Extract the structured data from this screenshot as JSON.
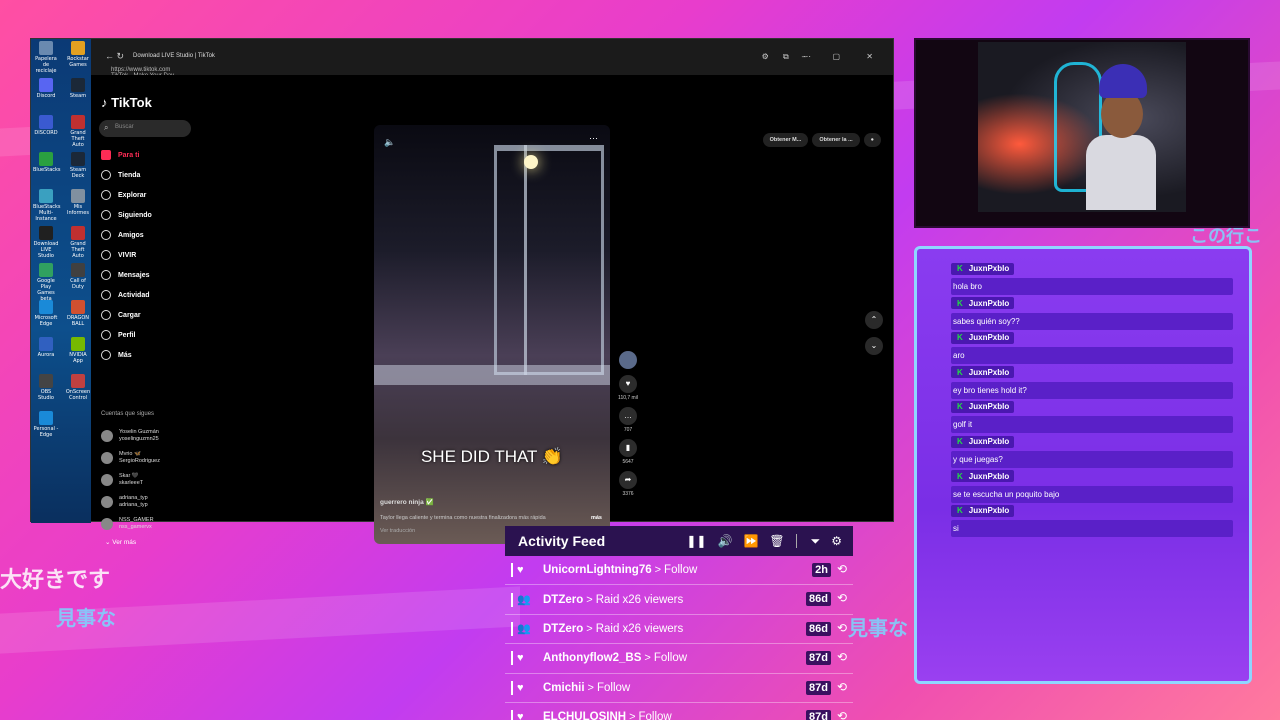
{
  "colors": {
    "accent": "#fe2c55",
    "chat_bg": "#7a2ee6",
    "chat_border": "#8fd6ff",
    "feed_header": "#2b1250",
    "kick_green": "#22dd44"
  },
  "overlay_text": {
    "jp1": "大好きです",
    "jp2": "見事な",
    "jp3": "見事な",
    "jp4": "この行こ"
  },
  "browser": {
    "title": "Download LIVE Studio | TikTok",
    "url": "https://www.tiktok.com",
    "subtitle": "TikTok - Make Your Day"
  },
  "desktop_icons": [
    "Papelera de reciclaje",
    "Rockstar Games",
    "Discord",
    "Steam",
    "DISCORD",
    "Grand Theft Auto",
    "BlueStacks",
    "Steam Deck",
    "BlueStacks Multi-Instance",
    "Mis Informes",
    "Download LIVE Studio",
    "Grand Theft Auto",
    "Google Play Games beta",
    "Call of Duty",
    "Microsoft Edge",
    "DRAGON BALL",
    "Aurora",
    "NVIDIA App",
    "OBS Studio",
    "OnScreen Control",
    "Personal - Edge"
  ],
  "tiktok": {
    "logo": "TikTok",
    "search_placeholder": "Buscar",
    "nav": [
      {
        "label": "Para ti",
        "icon": "home-icon"
      },
      {
        "label": "Tienda",
        "icon": "shop-icon"
      },
      {
        "label": "Explorar",
        "icon": "compass-icon"
      },
      {
        "label": "Siguiendo",
        "icon": "following-icon"
      },
      {
        "label": "Amigos",
        "icon": "friends-icon"
      },
      {
        "label": "VIVIR",
        "icon": "live-icon"
      },
      {
        "label": "Mensajes",
        "icon": "message-icon"
      },
      {
        "label": "Actividad",
        "icon": "activity-icon"
      },
      {
        "label": "Cargar",
        "icon": "upload-icon"
      },
      {
        "label": "Perfil",
        "icon": "profile-icon"
      },
      {
        "label": "Más",
        "icon": "more-icon"
      }
    ],
    "following_header": "Cuentas que sigues",
    "following": [
      {
        "name": "Yoselin Guzmán",
        "handle": "yoselinguzmn25"
      },
      {
        "name": "Mvrio 🦋",
        "handle": "SergioRodriguez"
      },
      {
        "name": "Skar 🖤",
        "handle": "skarleeeT"
      },
      {
        "name": "adriana_typ",
        "handle": "adriana_typ"
      },
      {
        "name": "NSS_GAMER",
        "handle": "nss_gamervx"
      }
    ],
    "ver_mas": "Ver más",
    "top_buttons": [
      "Obtener M...",
      "Obtener la ..."
    ],
    "video": {
      "caption": "SHE DID THAT 👏",
      "author": "guerrero ninja ✅",
      "description": "Taylor llega caliente y termina como nuestra finalizadora más rápida",
      "more": "más",
      "translation": "Ver traducción"
    },
    "actions": [
      {
        "icon": "heart-icon",
        "glyph": "♥",
        "count": "110,7 mil"
      },
      {
        "icon": "comment-icon",
        "glyph": "…",
        "count": "707"
      },
      {
        "icon": "bookmark-icon",
        "glyph": "▮",
        "count": "5647"
      },
      {
        "icon": "share-icon",
        "glyph": "➦",
        "count": "3376"
      }
    ]
  },
  "chat": {
    "messages": [
      {
        "user": "JuxnPxblo",
        "text": "hola bro"
      },
      {
        "user": "JuxnPxblo",
        "text": "sabes quién soy??"
      },
      {
        "user": "JuxnPxblo",
        "text": "aro"
      },
      {
        "user": "JuxnPxblo",
        "text": "ey bro tienes hold it?"
      },
      {
        "user": "JuxnPxblo",
        "text": "golf it"
      },
      {
        "user": "JuxnPxblo",
        "text": "y que juegas?"
      },
      {
        "user": "JuxnPxblo",
        "text": "se te escucha un poquito bajo"
      },
      {
        "user": "JuxnPxblo",
        "text": "si"
      }
    ]
  },
  "activity_feed": {
    "title": "Activity Feed",
    "events": [
      {
        "user": "UnicornLightning76",
        "action": "Follow",
        "age": "2h",
        "icon": "heart-icon"
      },
      {
        "user": "DTZero",
        "action": "Raid x26 viewers",
        "age": "86d",
        "icon": "raid-icon"
      },
      {
        "user": "DTZero",
        "action": "Raid x26 viewers",
        "age": "86d",
        "icon": "raid-icon"
      },
      {
        "user": "Anthonyflow2_BS",
        "action": "Follow",
        "age": "87d",
        "icon": "heart-icon"
      },
      {
        "user": "Cmichii",
        "action": "Follow",
        "age": "87d",
        "icon": "heart-icon"
      },
      {
        "user": "ELCHULOSINH",
        "action": "Follow",
        "age": "87d",
        "icon": "heart-icon"
      }
    ]
  }
}
